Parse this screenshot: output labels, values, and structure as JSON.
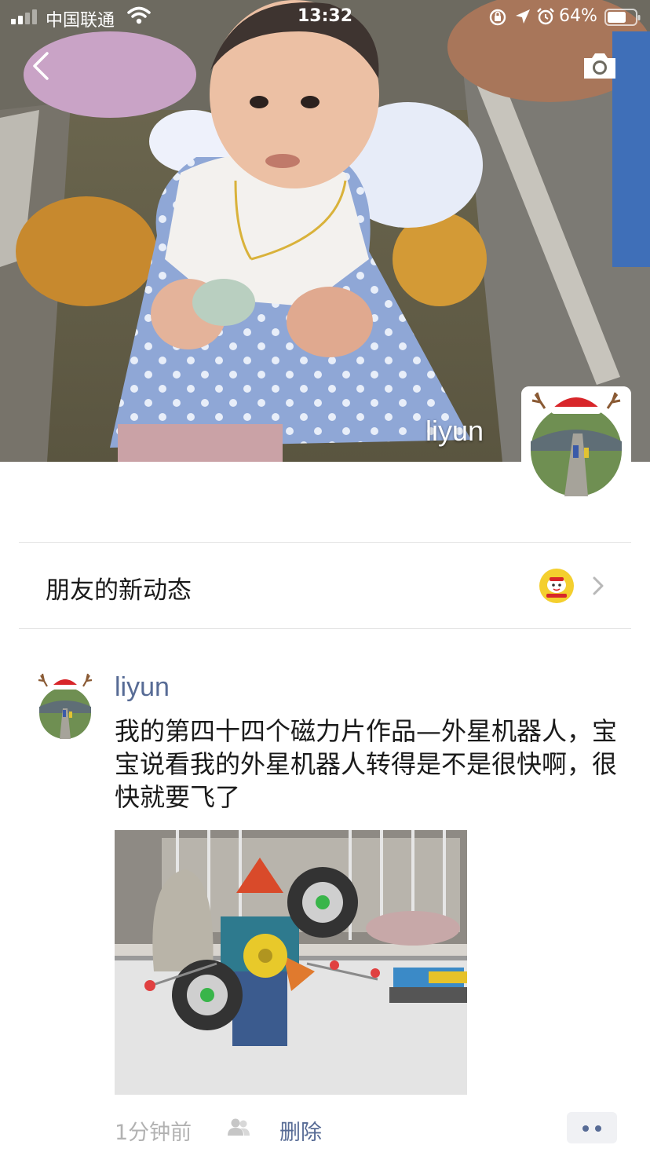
{
  "status_bar": {
    "carrier": "中国联通",
    "time": "13:32",
    "battery_percent": "64%",
    "icons": [
      "signal-icon",
      "wifi-icon",
      "orientation-lock-icon",
      "location-icon",
      "alarm-icon",
      "battery-icon"
    ]
  },
  "header": {
    "back_icon": "chevron-left-icon",
    "camera_icon": "camera-icon"
  },
  "profile": {
    "name": "liyun"
  },
  "friend_updates": {
    "label": "朋友的新动态",
    "chevron_icon": "chevron-right-icon"
  },
  "post": {
    "author": "liyun",
    "text": "我的第四十四个磁力片作品—外星机器人，宝宝说看我的外星机器人转得是不是很快啊，很快就要飞了",
    "time": "1分钟前",
    "visibility_icon": "friends-icon",
    "delete_label": "删除",
    "more_icon": "more-dots-icon"
  },
  "colors": {
    "link_blue": "#576b95",
    "text_primary": "#1a1a1a",
    "text_secondary": "#b2b2b2",
    "divider": "#e3e3e3",
    "more_button_bg": "#f0f1f4"
  }
}
